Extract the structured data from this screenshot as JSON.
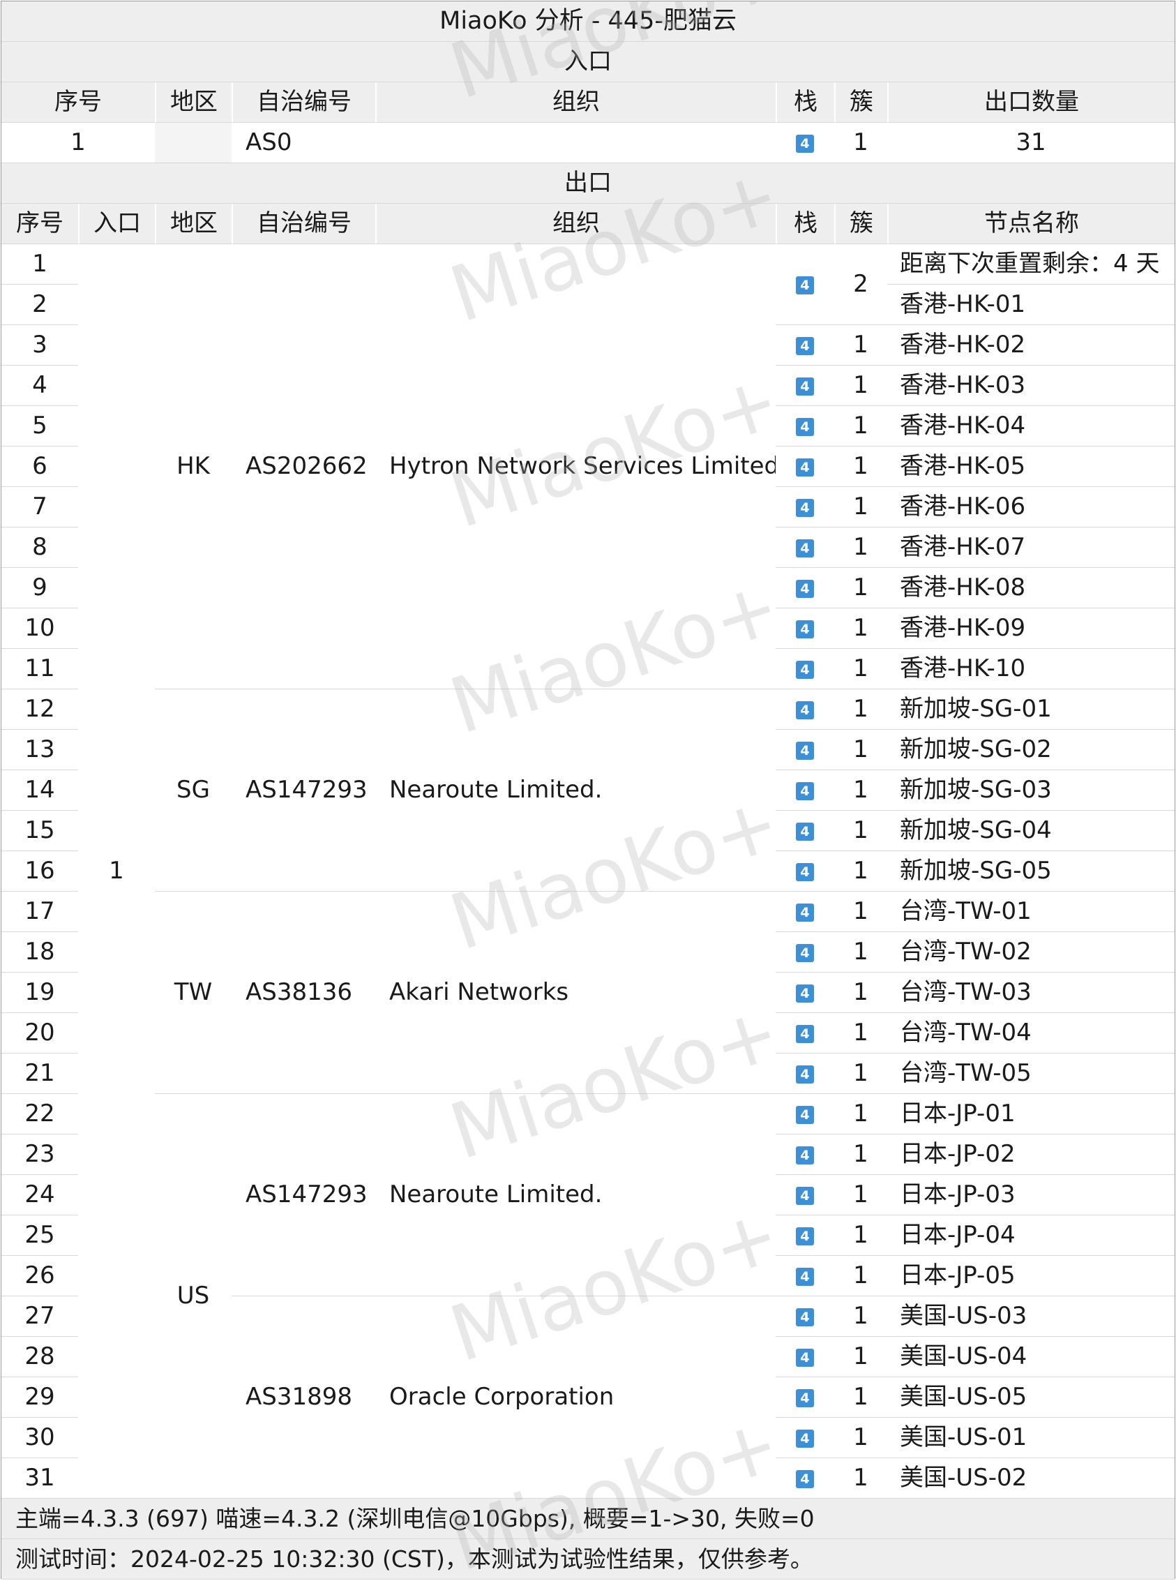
{
  "title": "MiaoKo 分析 - 445-肥猫云",
  "entry_section_title": "入口",
  "entry_headers": {
    "idx": "序号",
    "region": "地区",
    "asn": "自治编号",
    "org": "组织",
    "stack": "栈",
    "cluster": "簇",
    "count": "出口数量"
  },
  "entry_row": {
    "idx": "1",
    "region": "",
    "asn": "AS0",
    "org": "",
    "stack": "4",
    "cluster": "1",
    "count": "31"
  },
  "exit_section_title": "出口",
  "exit_headers": {
    "idx": "序号",
    "entry": "入口",
    "region": "地区",
    "asn": "自治编号",
    "org": "组织",
    "stack": "栈",
    "cluster": "簇",
    "name": "节点名称"
  },
  "entry_value": "1",
  "region_groups": [
    {
      "region": "HK",
      "rows": 11
    },
    {
      "region": "SG",
      "rows": 5
    },
    {
      "region": "TW",
      "rows": 5
    },
    {
      "region": "US",
      "rows": 10
    }
  ],
  "asn_groups": [
    {
      "asn": "AS202662",
      "org": "Hytron Network Services Limited",
      "rows": 11
    },
    {
      "asn": "AS147293",
      "org": "Nearoute Limited.",
      "rows": 5
    },
    {
      "asn": "AS38136",
      "org": "Akari Networks",
      "rows": 5
    },
    {
      "asn": "AS147293",
      "org": "Nearoute Limited.",
      "rows": 5
    },
    {
      "asn": "AS31898",
      "org": "Oracle Corporation",
      "rows": 5
    }
  ],
  "stack_groups": [
    {
      "stack": "4",
      "cluster": "2",
      "rows": 2
    },
    {
      "stack": "4",
      "cluster": "1",
      "rows": 1
    },
    {
      "stack": "4",
      "cluster": "1",
      "rows": 1
    },
    {
      "stack": "4",
      "cluster": "1",
      "rows": 1
    },
    {
      "stack": "4",
      "cluster": "1",
      "rows": 1
    },
    {
      "stack": "4",
      "cluster": "1",
      "rows": 1
    },
    {
      "stack": "4",
      "cluster": "1",
      "rows": 1
    },
    {
      "stack": "4",
      "cluster": "1",
      "rows": 1
    },
    {
      "stack": "4",
      "cluster": "1",
      "rows": 1
    },
    {
      "stack": "4",
      "cluster": "1",
      "rows": 1
    },
    {
      "stack": "4",
      "cluster": "1",
      "rows": 1
    },
    {
      "stack": "4",
      "cluster": "1",
      "rows": 1
    },
    {
      "stack": "4",
      "cluster": "1",
      "rows": 1
    },
    {
      "stack": "4",
      "cluster": "1",
      "rows": 1
    },
    {
      "stack": "4",
      "cluster": "1",
      "rows": 1
    },
    {
      "stack": "4",
      "cluster": "1",
      "rows": 1
    },
    {
      "stack": "4",
      "cluster": "1",
      "rows": 1
    },
    {
      "stack": "4",
      "cluster": "1",
      "rows": 1
    },
    {
      "stack": "4",
      "cluster": "1",
      "rows": 1
    },
    {
      "stack": "4",
      "cluster": "1",
      "rows": 1
    },
    {
      "stack": "4",
      "cluster": "1",
      "rows": 1
    },
    {
      "stack": "4",
      "cluster": "1",
      "rows": 1
    },
    {
      "stack": "4",
      "cluster": "1",
      "rows": 1
    },
    {
      "stack": "4",
      "cluster": "1",
      "rows": 1
    },
    {
      "stack": "4",
      "cluster": "1",
      "rows": 1
    },
    {
      "stack": "4",
      "cluster": "1",
      "rows": 1
    },
    {
      "stack": "4",
      "cluster": "1",
      "rows": 1
    },
    {
      "stack": "4",
      "cluster": "1",
      "rows": 1
    },
    {
      "stack": "4",
      "cluster": "1",
      "rows": 1
    },
    {
      "stack": "4",
      "cluster": "1",
      "rows": 1
    }
  ],
  "node_names": [
    "距离下次重置剩余：4 天",
    "香港-HK-01",
    "香港-HK-02",
    "香港-HK-03",
    "香港-HK-04",
    "香港-HK-05",
    "香港-HK-06",
    "香港-HK-07",
    "香港-HK-08",
    "香港-HK-09",
    "香港-HK-10",
    "新加坡-SG-01",
    "新加坡-SG-02",
    "新加坡-SG-03",
    "新加坡-SG-04",
    "新加坡-SG-05",
    "台湾-TW-01",
    "台湾-TW-02",
    "台湾-TW-03",
    "台湾-TW-04",
    "台湾-TW-05",
    "日本-JP-01",
    "日本-JP-02",
    "日本-JP-03",
    "日本-JP-04",
    "日本-JP-05",
    "美国-US-03",
    "美国-US-04",
    "美国-US-05",
    "美国-US-01",
    "美国-US-02"
  ],
  "footer": {
    "line1": "主端=4.3.3 (697) 喵速=4.3.2 (深圳电信@10Gbps), 概要=1->30, 失败=0",
    "line2": "测试时间：2024-02-25 10:32:30 (CST)，本测试为试验性结果，仅供参考。"
  },
  "watermark": "MiaoKo+",
  "colors": {
    "header_bg": "#eeeeee",
    "badge": "#3d8fd6",
    "border": "#d8d8d8"
  }
}
